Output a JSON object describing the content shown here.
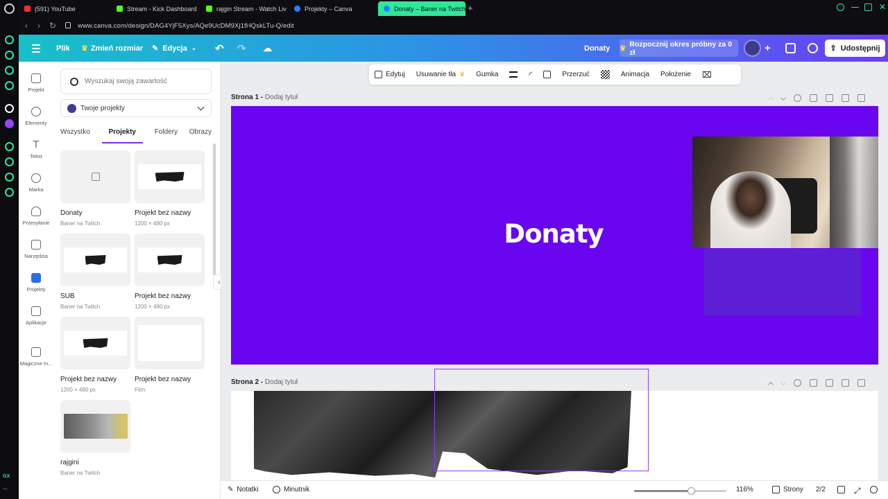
{
  "browser": {
    "tabs": [
      {
        "label": "(591) YouTube",
        "color": "#ff2a2a"
      },
      {
        "label": "Stream - Kick Dashboard",
        "color": "#53fc18"
      },
      {
        "label": "rajgin Stream - Watch Liv",
        "color": "#53fc18"
      },
      {
        "label": "Projekty – Canva",
        "color": "#2b7fff"
      },
      {
        "label": "Donaty – Baner na Twitch",
        "color": "#2ee89a"
      }
    ],
    "url": "www.canva.com/design/DAG4YjF5Xys/AQe9UcDM9Xj1fHQskLTu-Q/edit",
    "sidebar_badge": "GX"
  },
  "topbar": {
    "menu": [
      "Plik",
      "Zmień rozmiar",
      "Edycja"
    ],
    "design_name": "Donaty",
    "trial_button": "Rozpocznij okres próbny za 0 zł",
    "share_button": "Udostępnij"
  },
  "rail": [
    {
      "label": "Projekt",
      "icon": "layout-icon"
    },
    {
      "label": "Elementy",
      "icon": "shapes-icon"
    },
    {
      "label": "Tekst",
      "icon": "text-icon"
    },
    {
      "label": "Marka",
      "icon": "brand-icon"
    },
    {
      "label": "Przesyłanie",
      "icon": "upload-cloud-icon"
    },
    {
      "label": "Narzędzia",
      "icon": "pen-tool-icon"
    },
    {
      "label": "Projekty",
      "icon": "folder-icon"
    },
    {
      "label": "Aplikacje",
      "icon": "apps-icon"
    },
    {
      "label": "Magiczne m...",
      "icon": "magic-media-icon"
    }
  ],
  "panel": {
    "search_placeholder": "Wyszukaj swoją zawartość",
    "dropdown_value": "Twoje projekty",
    "tabs": [
      "Wszystko",
      "Projekty",
      "Foldery",
      "Obrazy"
    ],
    "active_tab": "Projekty",
    "cards": [
      {
        "title": "Donaty",
        "sub": "Baner na Twitch"
      },
      {
        "title": "Projekt bez nazwy",
        "sub": "1200 × 480 px"
      },
      {
        "title": "SUB",
        "sub": "Baner na Twitch"
      },
      {
        "title": "Projekt bez nazwy",
        "sub": "1200 × 480 px"
      },
      {
        "title": "Projekt bez nazwy",
        "sub": "1200 × 480 px"
      },
      {
        "title": "Projekt bez nazwy",
        "sub": "Film"
      },
      {
        "title": "rajgini",
        "sub": "Baner na Twitch"
      }
    ]
  },
  "toolbar": {
    "items": [
      "Edytuj",
      "Usuwanie tła",
      "Gumka",
      "Przerzuć",
      "Animacja",
      "Położenie"
    ]
  },
  "pages": [
    {
      "label": "Strona 1 -",
      "title_placeholder": "Dodaj tytuł",
      "heading": "Donaty",
      "background": "#6a05f0"
    },
    {
      "label": "Strona 2 -",
      "title_placeholder": "Dodaj tytuł"
    }
  ],
  "bottombar": {
    "notes": "Notatki",
    "timer": "Minutnik",
    "zoom": "116%",
    "zoom_fraction": 0.62,
    "pages_label": "Strony",
    "page_count": "2/2"
  }
}
